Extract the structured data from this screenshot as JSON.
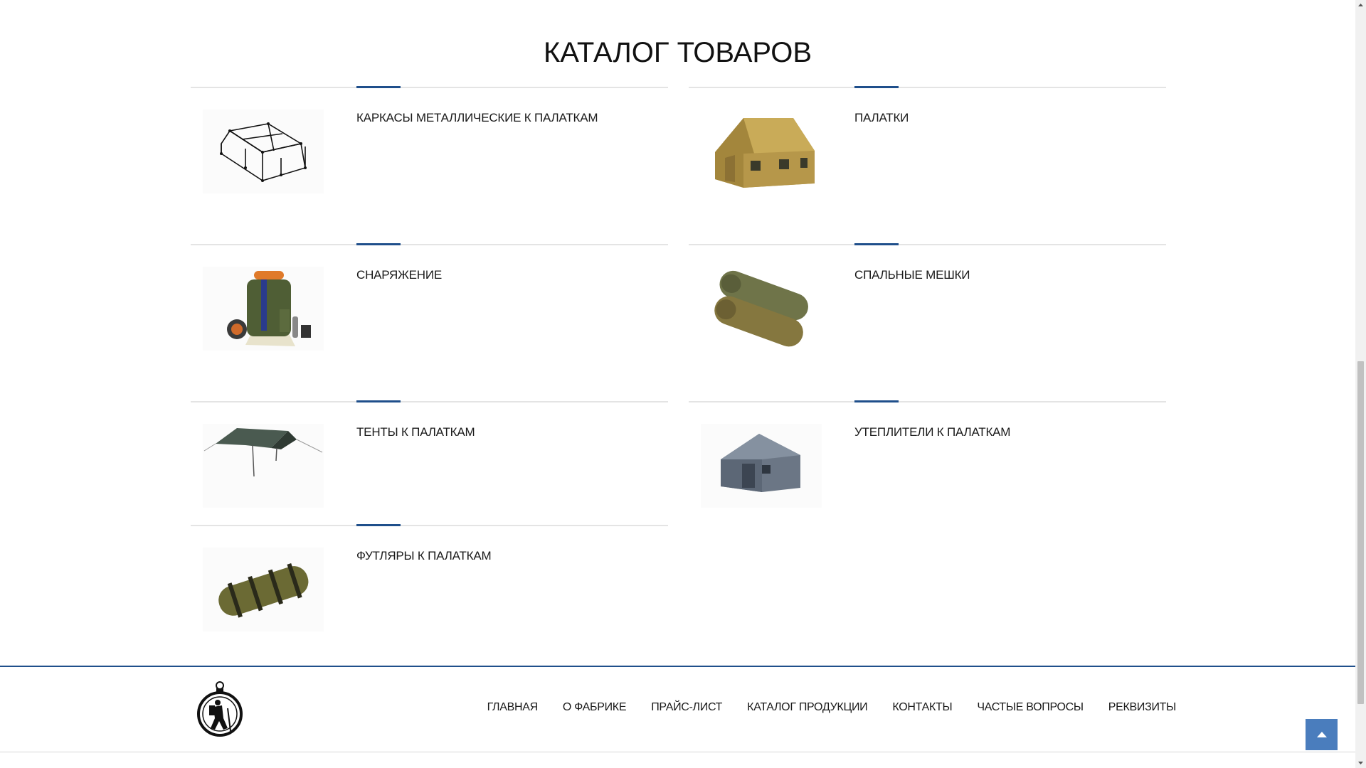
{
  "page": {
    "title": "КАТАЛОГ ТОВАРОВ"
  },
  "catalog": {
    "items": [
      {
        "title": "КАРКАСЫ МЕТАЛЛИЧЕСКИЕ К ПАЛАТКАМ",
        "image": "tent-frame-image"
      },
      {
        "title": "ПАЛАТКИ",
        "image": "tent-image"
      },
      {
        "title": "СНАРЯЖЕНИЕ",
        "image": "backpack-gear-image"
      },
      {
        "title": "СПАЛЬНЫЕ МЕШКИ",
        "image": "sleeping-bags-image"
      },
      {
        "title": "ТЕНТЫ К ПАЛАТКАМ",
        "image": "tarp-awning-image"
      },
      {
        "title": "УТЕПЛИТЕЛИ К ПАЛАТКАМ",
        "image": "insulated-tent-image"
      },
      {
        "title": "ФУТЛЯРЫ К ПАЛАТКАМ",
        "image": "tent-case-image"
      }
    ]
  },
  "footer": {
    "logo": "hiker-compass-logo",
    "nav": [
      {
        "label": "ГЛАВНАЯ"
      },
      {
        "label": "О ФАБРИКЕ"
      },
      {
        "label": "ПРАЙС-ЛИСТ"
      },
      {
        "label": "КАТАЛОГ ПРОДУКЦИИ"
      },
      {
        "label": "КОНТАКТЫ"
      },
      {
        "label": "ЧАСТЫЕ ВОПРОСЫ"
      },
      {
        "label": "РЕКВИЗИТЫ"
      }
    ]
  },
  "colors": {
    "accent": "#1f4f8b",
    "scroll_button": "#4a7dbd",
    "divider": "#e4e4e4"
  },
  "scroll_top_icon": "arrow-up-icon"
}
